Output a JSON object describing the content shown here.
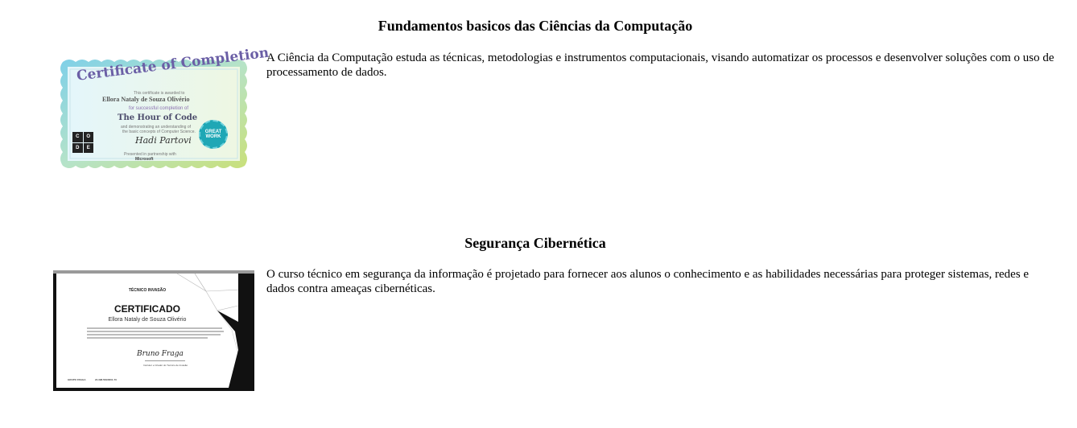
{
  "sections": [
    {
      "title": "Fundamentos basicos das Ciências da Computação",
      "description": "A Ciência da Computação estuda as técnicas, metodologias e instrumentos computacionais, visando automatizar os processos e desenvolver soluções com o uso de processamento de dados.",
      "certificate": {
        "heading": "Certificate of Completion",
        "awarded_line": "This certificate is awarded to",
        "recipient": "Ellora Nataly de Souza Olivério",
        "completion_line": "for successful completion of",
        "course": "The Hour of Code",
        "understanding_line": "and demonstrating an understanding of",
        "basic_line": "the basic concepts of Computer Science.",
        "code_letters": [
          "C",
          "O",
          "D",
          "E"
        ],
        "badge_line1": "GREAT",
        "badge_line2": "WORK",
        "signature": "Hadi Partovi",
        "footer_line1": "Presented in partnership with",
        "footer_line2": "Microsoft"
      }
    },
    {
      "title": "Segurança Cibernética",
      "description": "O curso técnico em segurança da informação é projetado para fornecer aos alunos o conhecimento e as habilidades necessárias para proteger sistemas, redes e dados contra ameaças cibernéticas.",
      "certificate": {
        "brand": "TÉCNICO INVASÃO",
        "heading": "CERTIFICADO",
        "recipient": "Ellora Nataly de Souza Olivério",
        "signature": "Bruno Fraga",
        "signer_role": "Instrutor e Criador do Técnico de Invasão",
        "left_label": "GRUPO FRAGA",
        "mid_label": "24.398.509/0001-70"
      }
    }
  ],
  "colors": {
    "cert1_title": "#6b5fa6",
    "cert1_badge": "#1fa7b5",
    "cert2_frame": "#111111"
  }
}
